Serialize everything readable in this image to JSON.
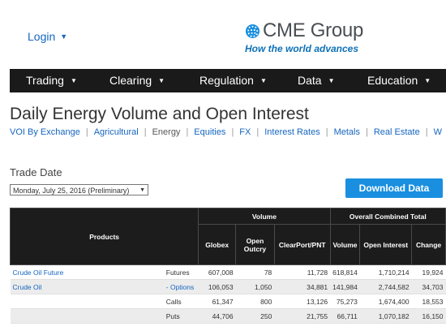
{
  "header": {
    "login_label": "Login",
    "logo_text": "CME Group",
    "tagline": "How the world advances"
  },
  "nav": [
    "Trading",
    "Clearing",
    "Regulation",
    "Data",
    "Education"
  ],
  "page": {
    "title": "Daily Energy Volume and Open Interest",
    "subnav": [
      "VOI By Exchange",
      "Agricultural",
      "Energy",
      "Equities",
      "FX",
      "Interest Rates",
      "Metals",
      "Real Estate",
      "W"
    ],
    "subnav_active": "Energy"
  },
  "trade_date": {
    "label": "Trade Date",
    "selected": "Monday, July 25, 2016 (Preliminary)"
  },
  "download_label": "Download Data",
  "table": {
    "group_products": "Products",
    "group_volume": "Volume",
    "group_oi": "Overall Combined Total",
    "columns": [
      "Globex",
      "Open Outcry",
      "ClearPort/PNT",
      "Volume",
      "Open Interest",
      "Change"
    ],
    "rows": [
      {
        "product": "Crude Oil Future",
        "type": "Futures",
        "globex": "607,008",
        "outcry": "78",
        "clearport": "11,728",
        "volume": "618,814",
        "oi": "1,710,214",
        "change": "19,924"
      },
      {
        "product": "Crude Oil",
        "type": "- Options",
        "globex": "106,053",
        "outcry": "1,050",
        "clearport": "34,881",
        "volume": "141,984",
        "oi": "2,744,582",
        "change": "34,703"
      },
      {
        "product": "",
        "type": "Calls",
        "globex": "61,347",
        "outcry": "800",
        "clearport": "13,126",
        "volume": "75,273",
        "oi": "1,674,400",
        "change": "18,553"
      },
      {
        "product": "",
        "type": "Puts",
        "globex": "44,706",
        "outcry": "250",
        "clearport": "21,755",
        "volume": "66,711",
        "oi": "1,070,182",
        "change": "16,150"
      }
    ]
  },
  "colors": {
    "link": "#1565c0",
    "nav_bg": "#1a1a1a",
    "button": "#1a8fe0",
    "logo_blue": "#0e71b8"
  }
}
